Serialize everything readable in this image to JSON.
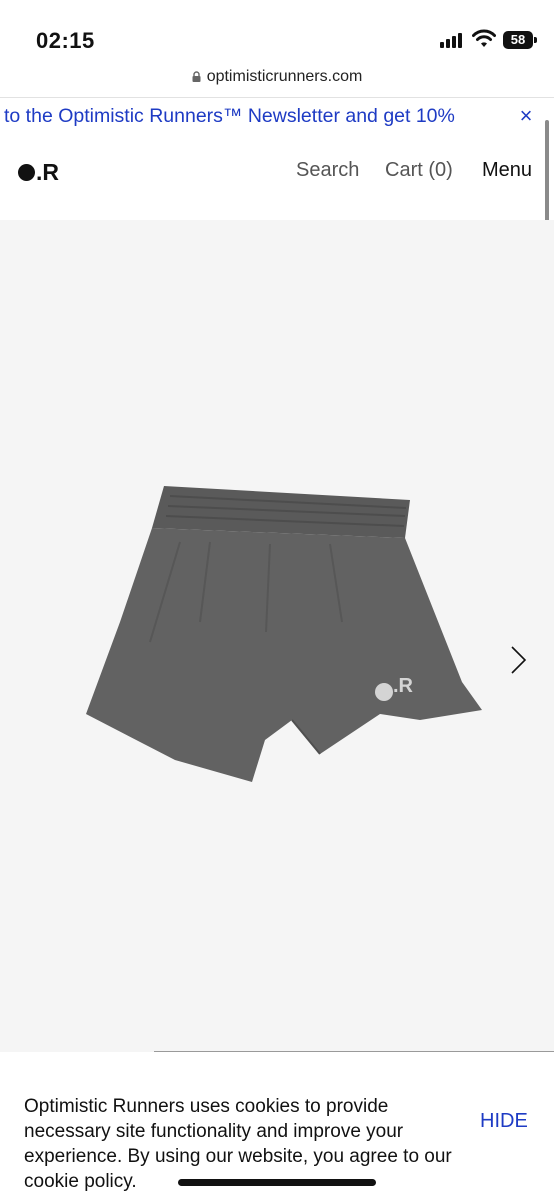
{
  "status_bar": {
    "time": "02:15",
    "battery": "58"
  },
  "browser": {
    "url": "optimisticrunners.com"
  },
  "announcement": {
    "text": "to the Optimistic Runners™ Newsletter and get 10%",
    "close_symbol": "×"
  },
  "header": {
    "logo_text": ".R",
    "nav": {
      "search": "Search",
      "cart": "Cart (0)",
      "menu": "Menu"
    }
  },
  "product": {
    "image_logo_text": ".R",
    "colors": {
      "fabric": "#5f5f5f",
      "background": "#f5f5f5"
    }
  },
  "cookie_banner": {
    "text": "Optimistic Runners uses cookies to provide necessary site functionality and improve your experience. By using our website, you agree to our cookie policy.",
    "hide_label": "HIDE"
  },
  "colors": {
    "accent_blue": "#1e3bc4",
    "text": "#111111",
    "muted_text": "#555555"
  }
}
